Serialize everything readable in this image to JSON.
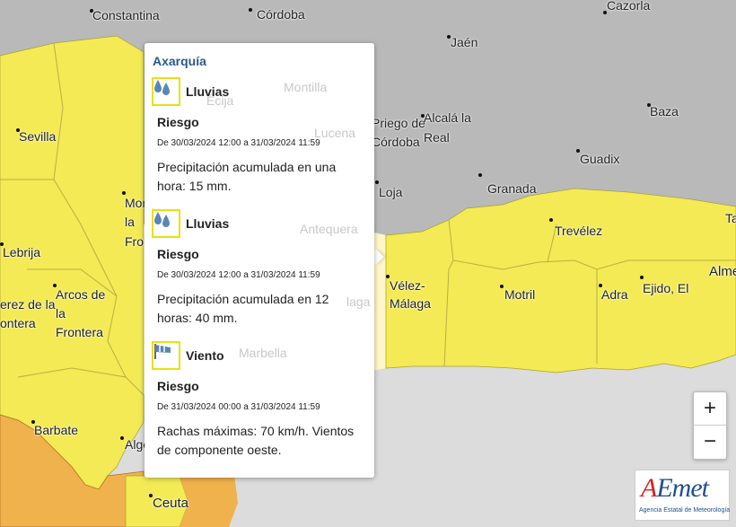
{
  "map": {
    "colors": {
      "land_gray": "#b9b9b9",
      "sea": "#dcdcdc",
      "warning_yellow": "#f3ea55",
      "warning_orange": "#f0b24c",
      "border": "#a8a030"
    },
    "places": [
      {
        "name": "Constantina",
        "id": "constantina"
      },
      {
        "name": "Córdoba",
        "id": "cordoba"
      },
      {
        "name": "Cazorla",
        "id": "cazorla"
      },
      {
        "name": "Jaén",
        "id": "jaen"
      },
      {
        "name": "Sevilla",
        "id": "sevilla"
      },
      {
        "name": "Baza",
        "id": "baza"
      },
      {
        "name": "Priego de",
        "id": "priego-1"
      },
      {
        "name": "Córdoba",
        "id": "priego-2"
      },
      {
        "name": "Alcalá la",
        "id": "alcala-1"
      },
      {
        "name": "Real",
        "id": "alcala-2"
      },
      {
        "name": "Guadix",
        "id": "guadix"
      },
      {
        "name": "Loja",
        "id": "loja"
      },
      {
        "name": "Granada",
        "id": "granada"
      },
      {
        "name": "Ta",
        "id": "ta"
      },
      {
        "name": "Lebrija",
        "id": "lebrija"
      },
      {
        "name": "Morón de",
        "id": "moron-1"
      },
      {
        "name": "la",
        "id": "moron-2"
      },
      {
        "name": "Frontera",
        "id": "moron-3"
      },
      {
        "name": "Trevélez",
        "id": "trevelez"
      },
      {
        "name": "Vélez-",
        "id": "velez-1"
      },
      {
        "name": "Málaga",
        "id": "velez-2"
      },
      {
        "name": "Motril",
        "id": "motril"
      },
      {
        "name": "Adra",
        "id": "adra"
      },
      {
        "name": "Ejido, El",
        "id": "ejido"
      },
      {
        "name": "Alme",
        "id": "alme"
      },
      {
        "name": "Arcos de",
        "id": "arcos-1"
      },
      {
        "name": "la",
        "id": "arcos-2"
      },
      {
        "name": "Frontera",
        "id": "arcos-3"
      },
      {
        "name": "erez de la",
        "id": "jerez-1"
      },
      {
        "name": "ontera",
        "id": "jerez-2"
      },
      {
        "name": "Barbate",
        "id": "barbate"
      },
      {
        "name": "Alge",
        "id": "alge"
      },
      {
        "name": "Ceuta",
        "id": "ceuta"
      },
      {
        "name": "Montilla",
        "id": "montilla"
      },
      {
        "name": "Écija",
        "id": "ecija"
      },
      {
        "name": "Lucena",
        "id": "lucena"
      },
      {
        "name": "Antequera",
        "id": "antequera"
      },
      {
        "name": "laga",
        "id": "malaga"
      },
      {
        "name": "Marbella",
        "id": "marbella"
      }
    ]
  },
  "popup": {
    "zone": "Axarquía",
    "warnings": [
      {
        "type": "Lluvias",
        "icon": "rain-icon",
        "level": "Riesgo",
        "period": "De 30/03/2024 12:00 a 31/03/2024 11:59",
        "description": "Precipitación acumulada en una hora: 15 mm."
      },
      {
        "type": "Lluvias",
        "icon": "rain-icon",
        "level": "Riesgo",
        "period": "De 30/03/2024 12:00 a 31/03/2024 11:59",
        "description": "Precipitación acumulada en 12 horas: 40 mm."
      },
      {
        "type": "Viento",
        "icon": "wind-icon",
        "level": "Riesgo",
        "period": "De 31/03/2024 00:00 a 31/03/2024 11:59",
        "description": "Rachas máximas: 70 km/h. Vientos de componente oeste."
      }
    ]
  },
  "zoom": {
    "in": "+",
    "out": "−"
  },
  "logo": {
    "text": "AEmet",
    "subtitle": "Agencia Estatal de Meteorología"
  }
}
